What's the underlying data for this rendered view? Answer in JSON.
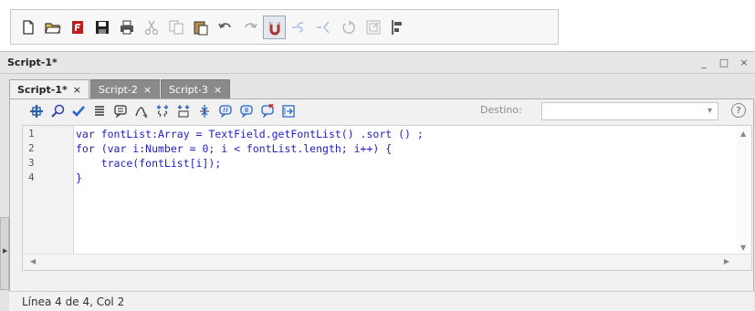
{
  "main_toolbar": {
    "buttons": [
      {
        "icon": "new-document-icon"
      },
      {
        "icon": "open-folder-icon"
      },
      {
        "icon": "flash-file-icon"
      },
      {
        "icon": "save-icon"
      },
      {
        "icon": "print-icon"
      },
      {
        "icon": "cut-icon",
        "disabled": true
      },
      {
        "icon": "copy-icon",
        "disabled": true
      },
      {
        "icon": "paste-icon"
      },
      {
        "icon": "undo-icon"
      },
      {
        "icon": "redo-icon",
        "disabled": true
      },
      {
        "icon": "snap-to-objects-icon",
        "pressed": true
      },
      {
        "icon": "smooth-icon",
        "disabled": true
      },
      {
        "icon": "straighten-icon",
        "disabled": true
      },
      {
        "icon": "rotate-icon",
        "disabled": true
      },
      {
        "icon": "scale-icon",
        "disabled": true
      },
      {
        "icon": "align-icon"
      }
    ]
  },
  "panel": {
    "title": "Script-1*",
    "controls": {
      "minimize": "_",
      "maximize": "□",
      "close": "×"
    }
  },
  "tabs": [
    {
      "label": "Script-1*",
      "close": "×",
      "active": true
    },
    {
      "label": "Script-2",
      "close": "×",
      "active": false
    },
    {
      "label": "Script-3",
      "close": "×",
      "active": false
    }
  ],
  "script_toolbar": {
    "buttons": [
      {
        "icon": "add-item-icon"
      },
      {
        "icon": "find-icon"
      },
      {
        "icon": "check-syntax-icon"
      },
      {
        "icon": "auto-format-icon"
      },
      {
        "icon": "code-hint-icon"
      },
      {
        "icon": "debug-options-icon"
      },
      {
        "icon": "collapse-between-braces-icon"
      },
      {
        "icon": "collapse-selection-icon"
      },
      {
        "icon": "expand-all-icon"
      },
      {
        "icon": "apply-block-comment-icon"
      },
      {
        "icon": "apply-line-comment-icon"
      },
      {
        "icon": "remove-comment-icon"
      },
      {
        "icon": "show-hide-toolbox-icon"
      }
    ],
    "destino_label": "Destino:",
    "destino_value": "",
    "help": "?"
  },
  "code": {
    "line_numbers": [
      "1",
      "2",
      "3",
      "4"
    ],
    "lines": [
      "var fontList:Array = TextField.getFontList() .sort () ;",
      "for (var i:Number = 0; i < fontList.length; i++) {",
      "    trace(fontList[i]);",
      "}"
    ]
  },
  "status": {
    "text": "Línea 4 de 4, Col 2"
  }
}
